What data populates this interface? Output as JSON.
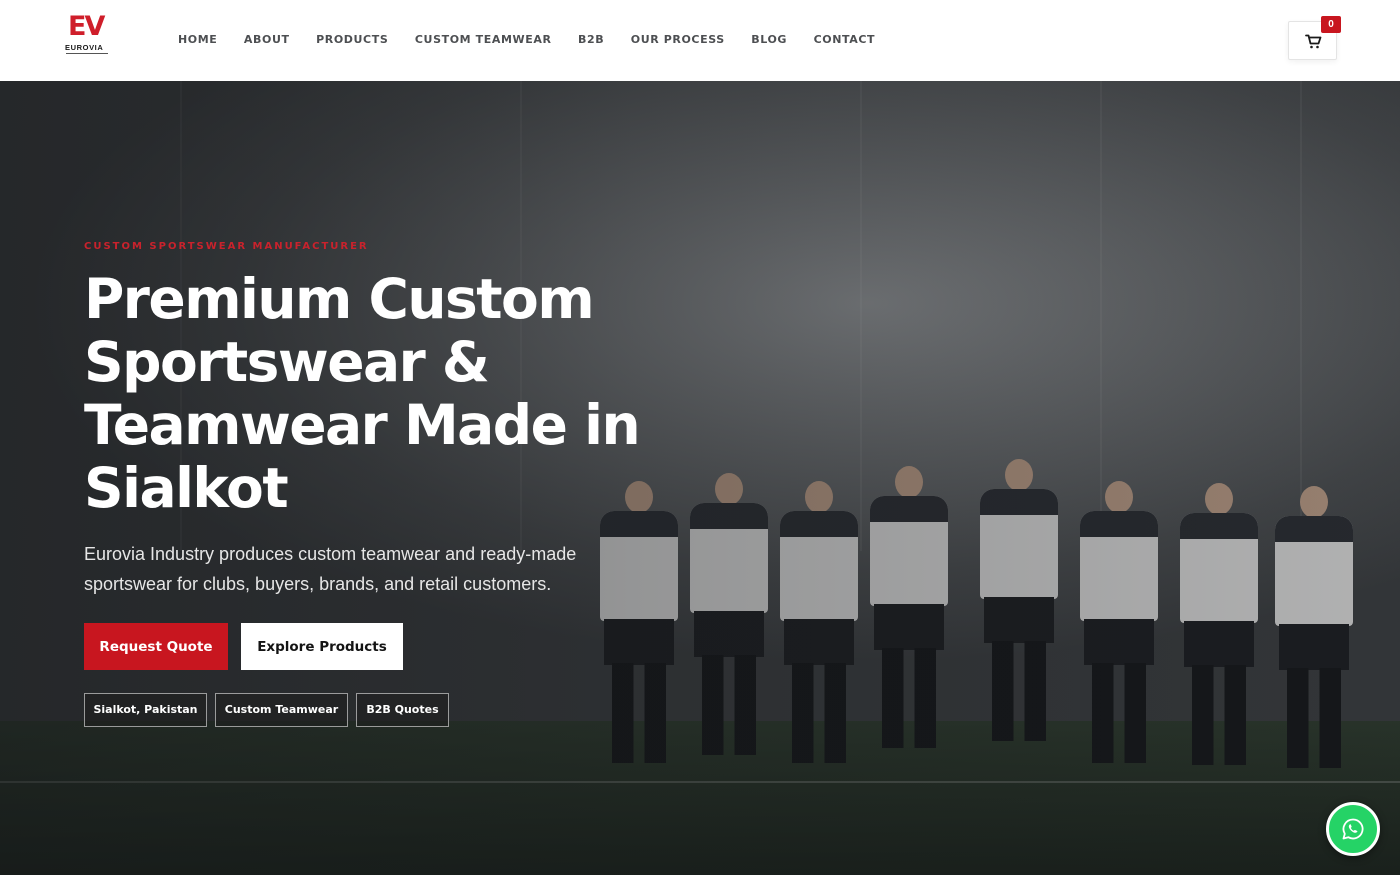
{
  "brand": {
    "logo_mark": "EV",
    "logo_name": "EUROVIA",
    "accent": "#c8161f"
  },
  "nav": {
    "items": [
      {
        "label": "HOME"
      },
      {
        "label": "ABOUT"
      },
      {
        "label": "PRODUCTS"
      },
      {
        "label": "CUSTOM TEAMWEAR"
      },
      {
        "label": "B2B"
      },
      {
        "label": "OUR PROCESS"
      },
      {
        "label": "BLOG"
      },
      {
        "label": "CONTACT"
      }
    ]
  },
  "cart": {
    "icon": "cart-icon",
    "count": "0"
  },
  "hero": {
    "eyebrow": "CUSTOM SPORTSWEAR MANUFACTURER",
    "headline": "Premium Custom Sportswear & Teamwear Made in Sialkot",
    "subheading": "Eurovia Industry produces custom teamwear and ready-made sportswear for clubs, buyers, brands, and retail customers.",
    "primary_cta": "Request Quote",
    "secondary_cta": "Explore Products",
    "tags": [
      {
        "label": "Sialkot, Pakistan"
      },
      {
        "label": "Custom Teamwear"
      },
      {
        "label": "B2B Quotes"
      }
    ],
    "background_image": "football-team-lineup"
  },
  "whatsapp": {
    "icon": "whatsapp-icon"
  }
}
